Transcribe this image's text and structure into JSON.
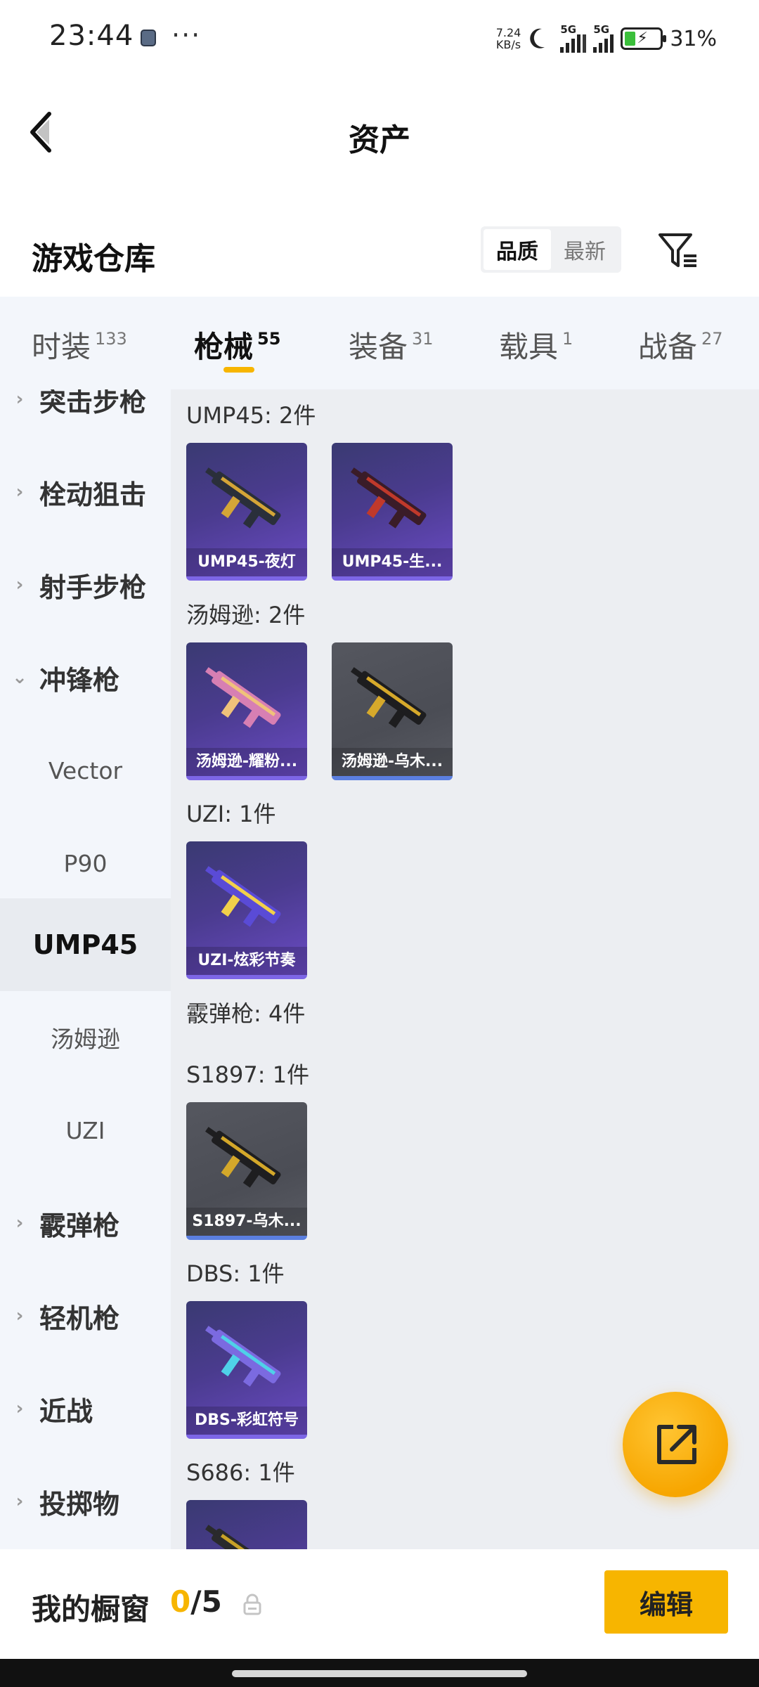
{
  "status_bar": {
    "time": "23:44",
    "dots": "···",
    "net_speed_value": "7.24",
    "net_speed_unit": "KB/s",
    "sim1_tag": "5G",
    "sim2_tag": "5G",
    "battery_percent": "31%",
    "battery_level": 0.31
  },
  "header": {
    "title": "资产",
    "back_icon": "chevron-left-icon"
  },
  "warehouse": {
    "title": "游戏仓库",
    "sort_options": [
      "品质",
      "最新"
    ],
    "selected_sort": "品质",
    "filter_icon": "filter-icon"
  },
  "tabs": [
    {
      "label": "时装",
      "count": "133"
    },
    {
      "label": "枪械",
      "count": "55",
      "active": true
    },
    {
      "label": "装备",
      "count": "31"
    },
    {
      "label": "载具",
      "count": "1"
    },
    {
      "label": "战备",
      "count": "27"
    }
  ],
  "sidebar": {
    "items": [
      {
        "label": "突击步枪",
        "type": "category",
        "expanded": false
      },
      {
        "label": "栓动狙击",
        "type": "category",
        "expanded": false
      },
      {
        "label": "射手步枪",
        "type": "category",
        "expanded": false
      },
      {
        "label": "冲锋枪",
        "type": "category",
        "expanded": true
      },
      {
        "label": "Vector",
        "type": "sub"
      },
      {
        "label": "P90",
        "type": "sub"
      },
      {
        "label": "UMP45",
        "type": "sub",
        "selected": true
      },
      {
        "label": "汤姆逊",
        "type": "sub"
      },
      {
        "label": "UZI",
        "type": "sub"
      },
      {
        "label": "霰弹枪",
        "type": "category",
        "expanded": false
      },
      {
        "label": "轻机枪",
        "type": "category",
        "expanded": false
      },
      {
        "label": "近战",
        "type": "category",
        "expanded": false
      },
      {
        "label": "投掷物",
        "type": "category",
        "expanded": false
      }
    ]
  },
  "content": {
    "sections": [
      {
        "title": "UMP45: 2件",
        "items": [
          {
            "label": "UMP45-夜灯",
            "rarity": "purple",
            "gun_color": "#2a2f3a",
            "accent": "#d4a537"
          },
          {
            "label": "UMP45-生...",
            "rarity": "purple",
            "gun_color": "#3a1c28",
            "accent": "#c0392b"
          }
        ]
      },
      {
        "title": "汤姆逊: 2件",
        "items": [
          {
            "label": "汤姆逊-耀粉...",
            "rarity": "purple",
            "gun_color": "#d77fb3",
            "accent": "#f0c27a"
          },
          {
            "label": "汤姆逊-乌木...",
            "rarity": "gray",
            "gun_color": "#1d1d1f",
            "accent": "#d6a92b"
          }
        ]
      },
      {
        "title": "UZI: 1件",
        "items": [
          {
            "label": "UZI-炫彩节奏",
            "rarity": "purple",
            "gun_color": "#5a4bd6",
            "accent": "#f2d04a"
          }
        ]
      },
      {
        "title": "霰弹枪: 4件",
        "items": []
      },
      {
        "title": "S1897: 1件",
        "items": [
          {
            "label": "S1897-乌木...",
            "rarity": "gray",
            "gun_color": "#1e1e20",
            "accent": "#d4a82a"
          }
        ]
      },
      {
        "title": "DBS: 1件",
        "items": [
          {
            "label": "DBS-彩虹符号",
            "rarity": "purple",
            "gun_color": "#7b6ae0",
            "accent": "#4fd1e8"
          }
        ]
      },
      {
        "title": "S686: 1件",
        "items": [
          {
            "label": "",
            "rarity": "purple",
            "gun_color": "#2a2a2c",
            "accent": "#c9a227"
          }
        ]
      }
    ]
  },
  "fab": {
    "icon": "share-icon"
  },
  "bottom_bar": {
    "title": "我的橱窗",
    "current": "0",
    "separator": "/",
    "max": "5",
    "lock_icon": "lock-icon",
    "edit_label": "编辑"
  },
  "colors": {
    "accent": "#f7b500",
    "purple_card": "#4a3b8e",
    "gray_card": "#4b4d55"
  }
}
